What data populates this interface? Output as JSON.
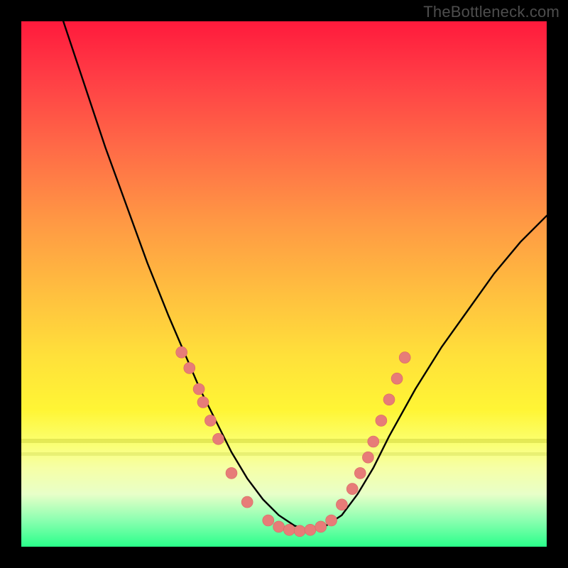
{
  "watermark": "TheBottleneck.com",
  "colors": {
    "gradient_top": "#ff1a3c",
    "gradient_mid": "#ffe13a",
    "gradient_bottom": "#2aff8a",
    "curve": "#000000",
    "dots": "#e77c78",
    "frame": "#000000"
  },
  "chart_data": {
    "type": "line",
    "title": "",
    "xlabel": "",
    "ylabel": "",
    "xlim": [
      0,
      100
    ],
    "ylim": [
      0,
      100
    ],
    "curve": {
      "name": "bottleneck-curve",
      "x": [
        8,
        12,
        16,
        20,
        24,
        28,
        31,
        34,
        37,
        40,
        43,
        46,
        49,
        52,
        55,
        58,
        61,
        64,
        67,
        70,
        75,
        80,
        85,
        90,
        95,
        100
      ],
      "y": [
        100,
        88,
        76,
        65,
        54,
        44,
        37,
        30,
        24,
        18,
        13,
        9,
        6,
        4,
        3,
        4,
        6,
        10,
        15,
        21,
        30,
        38,
        45,
        52,
        58,
        63
      ]
    },
    "series": [
      {
        "name": "left-arm-markers",
        "x": [
          30.5,
          32.0,
          33.8,
          34.6,
          36.0,
          37.5,
          40.0,
          43.0
        ],
        "y": [
          37.0,
          34.0,
          30.0,
          27.5,
          24.0,
          20.5,
          14.0,
          8.5
        ]
      },
      {
        "name": "valley-markers",
        "x": [
          47.0,
          49.0,
          51.0,
          53.0,
          55.0,
          57.0,
          59.0
        ],
        "y": [
          5.0,
          3.8,
          3.2,
          3.0,
          3.2,
          3.8,
          5.0
        ]
      },
      {
        "name": "right-arm-markers",
        "x": [
          61.0,
          63.0,
          64.5,
          66.0,
          67.0,
          68.5,
          70.0,
          71.5,
          73.0
        ],
        "y": [
          8.0,
          11.0,
          14.0,
          17.0,
          20.0,
          24.0,
          28.0,
          32.0,
          36.0
        ]
      }
    ],
    "annotations": []
  }
}
